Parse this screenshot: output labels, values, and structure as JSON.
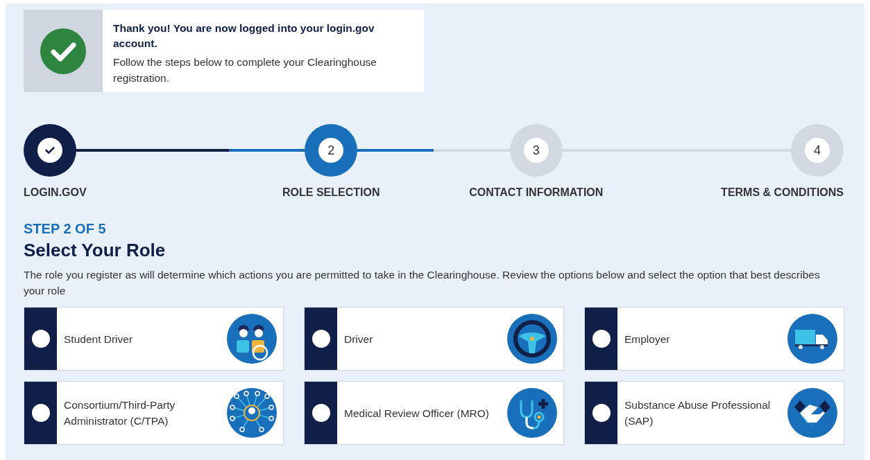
{
  "alert": {
    "title": "Thank you! You are now logged into your login.gov account.",
    "message": "Follow the steps below to complete your Clearinghouse registration."
  },
  "steps": [
    {
      "label": "LOGIN.GOV",
      "kind": "complete"
    },
    {
      "label": "ROLE SELECTION",
      "number": "2",
      "kind": "current"
    },
    {
      "label": "CONTACT INFORMATION",
      "number": "3",
      "kind": "upcoming"
    },
    {
      "label": "TERMS & CONDITIONS",
      "number": "4",
      "kind": "upcoming"
    }
  ],
  "step_counter": "STEP 2 OF 5",
  "heading": "Select Your Role",
  "description": "The role you register as will determine which actions you are permitted to take in the Clearinghouse. Review the options below and select the option that best describes your role",
  "roles": [
    {
      "label": "Student Driver",
      "kind": "student-driver",
      "selected": false
    },
    {
      "label": "Driver",
      "kind": "driver",
      "selected": false
    },
    {
      "label": "Employer",
      "kind": "employer",
      "selected": false
    },
    {
      "label": "Consortium/Third-Party Administrator (C/TPA)",
      "kind": "ctpa",
      "selected": false
    },
    {
      "label": "Medical Review Officer (MRO)",
      "kind": "mro",
      "selected": false
    },
    {
      "label": "Substance Abuse Professional (SAP)",
      "kind": "sap",
      "selected": false
    }
  ]
}
